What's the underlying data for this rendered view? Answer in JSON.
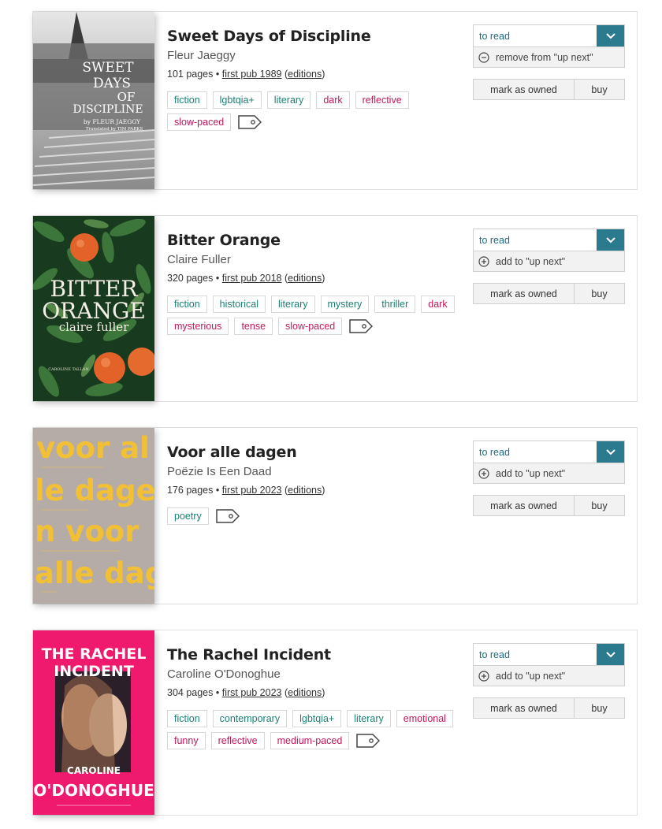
{
  "books": [
    {
      "title": "Sweet Days of Discipline",
      "author": "Fleur Jaeggy",
      "pages": "101 pages",
      "sep": "•",
      "first_pub": "first pub 1989",
      "editions_open": "(",
      "editions": "editions",
      "editions_close": ")",
      "genres": [
        "fiction",
        "lgbtqia+",
        "literary"
      ],
      "moods": [
        "dark",
        "reflective",
        "slow-paced"
      ],
      "status": "to read",
      "upnext": "remove from \"up next\"",
      "upnext_icon": "minus-circle-icon",
      "owned": "mark as owned",
      "buy": "buy",
      "cover": {
        "title_lines": [
          "SWEET",
          "DAYS",
          "OF",
          "DISCIPLINE"
        ],
        "author": "by FLEUR JAEGGY",
        "translator": "Translated by TIM PARKS"
      }
    },
    {
      "title": "Bitter Orange",
      "author": "Claire Fuller",
      "pages": "320 pages",
      "sep": "•",
      "first_pub": "first pub 2018",
      "editions_open": "(",
      "editions": "editions",
      "editions_close": ")",
      "genres": [
        "fiction",
        "historical",
        "literary",
        "mystery",
        "thriller"
      ],
      "moods": [
        "dark",
        "mysterious",
        "tense",
        "slow-paced"
      ],
      "status": "to read",
      "upnext": "add to \"up next\"",
      "upnext_icon": "plus-circle-icon",
      "owned": "mark as owned",
      "buy": "buy",
      "cover": {
        "title_lines": [
          "BITTER",
          "ORANGE"
        ],
        "author": "claire fuller",
        "blurb": "CAROLINE TALLAN"
      }
    },
    {
      "title": "Voor alle dagen",
      "author": "Poëzie Is Een Daad",
      "pages": "176 pages",
      "sep": "•",
      "first_pub": "first pub 2023",
      "editions_open": "(",
      "editions": "editions",
      "editions_close": ")",
      "genres": [
        "poetry"
      ],
      "moods": [],
      "status": "to read",
      "upnext": "add to \"up next\"",
      "upnext_icon": "plus-circle-icon",
      "owned": "mark as owned",
      "buy": "buy",
      "cover": {
        "lines": [
          "voor al",
          "le dage",
          "n voor",
          "alle dag"
        ]
      }
    },
    {
      "title": "The Rachel Incident",
      "author": "Caroline O'Donoghue",
      "pages": "304 pages",
      "sep": "•",
      "first_pub": "first pub 2023",
      "editions_open": "(",
      "editions": "editions",
      "editions_close": ")",
      "genres": [
        "fiction",
        "contemporary",
        "lgbtqia+",
        "literary"
      ],
      "moods": [
        "emotional",
        "funny",
        "reflective",
        "medium-paced"
      ],
      "status": "to read",
      "upnext": "add to \"up next\"",
      "upnext_icon": "plus-circle-icon",
      "owned": "mark as owned",
      "buy": "buy",
      "cover": {
        "title_lines": [
          "THE RACHEL",
          "INCIDENT"
        ],
        "author_lines": [
          "CAROLINE",
          "O'DONOGHUE"
        ]
      }
    }
  ],
  "colors": {
    "genre": "#1c7f73",
    "mood": "#c2185b",
    "accent": "#2b7a8e",
    "status_text": "#1c6b82"
  }
}
